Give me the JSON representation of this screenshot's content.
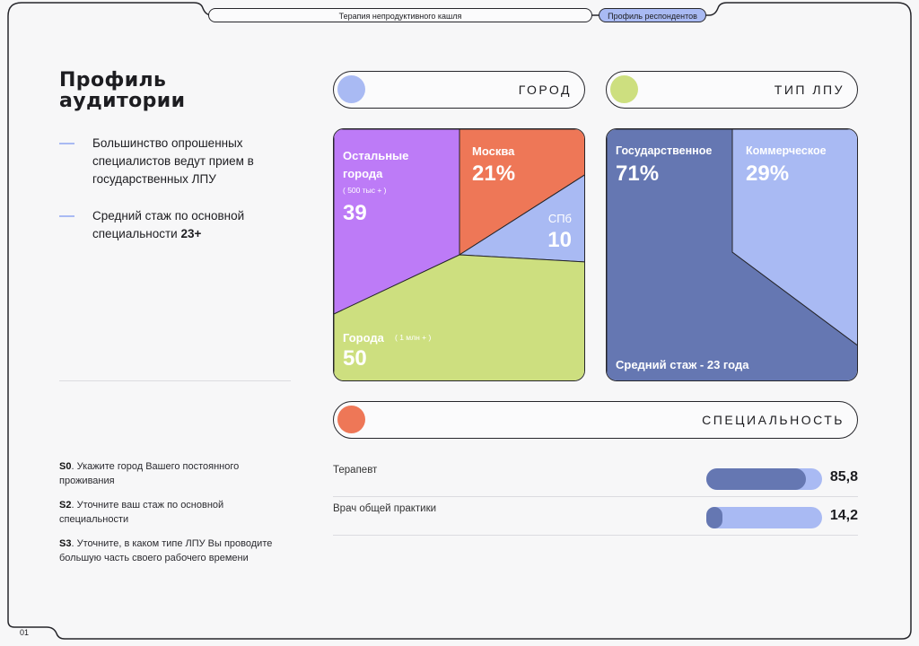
{
  "header": {
    "tab_therapy": "Терапия непродуктивного кашля",
    "tab_profile": "Профиль респондентов"
  },
  "footer": {
    "page_number": "01"
  },
  "left": {
    "title_line1": "Профиль",
    "title_line2": "аудитории",
    "bullet1": "Большинство опрошенных специалистов ведут прием в государственных ЛПУ",
    "bullet2_text": "Средний стаж по основной специальности ",
    "bullet2_bold": "23+",
    "questions": [
      {
        "code": "S0",
        "text": ". Укажите город Вашего постоянного проживания"
      },
      {
        "code": "S2",
        "text": ". Уточните ваш стаж по основной специальности"
      },
      {
        "code": "S3",
        "text": ". Уточните, в каком типе ЛПУ Вы проводите большую часть своего рабочего времени"
      }
    ]
  },
  "sections": {
    "city": "ГОРОД",
    "lpu": "ТИП ЛПУ",
    "specialty": "СПЕЦИАЛЬНОСТЬ"
  },
  "city_chart": {
    "other_label1": "Остальные",
    "other_label2": "города",
    "other_sub": "( 500 тыс + )",
    "other_value": "39",
    "moscow_label": "Москва",
    "moscow_value": "21%",
    "spb_label": "СПб",
    "spb_value": "10",
    "big_label": "Города",
    "big_sub": "( 1 млн + )",
    "big_value": "50"
  },
  "lpu_chart": {
    "state_label": "Государственное",
    "state_value": "71%",
    "commercial_label": "Коммерческое",
    "commercial_value": "29%",
    "experience": "Средний стаж - 23 года"
  },
  "colors": {
    "accent_blue": "#a9baf3",
    "navy": "#6577b2",
    "purple": "#bd7bf7",
    "orange": "#ee7757",
    "lime": "#cddf7f",
    "dark": "#26262b"
  },
  "chart_data": {
    "type": "bar",
    "categories": [
      "Терапевт",
      "Врач общей практики"
    ],
    "values": [
      85.8,
      14.2
    ],
    "value_labels": [
      "85,8",
      "14,2"
    ],
    "ylim": [
      0,
      100
    ]
  }
}
